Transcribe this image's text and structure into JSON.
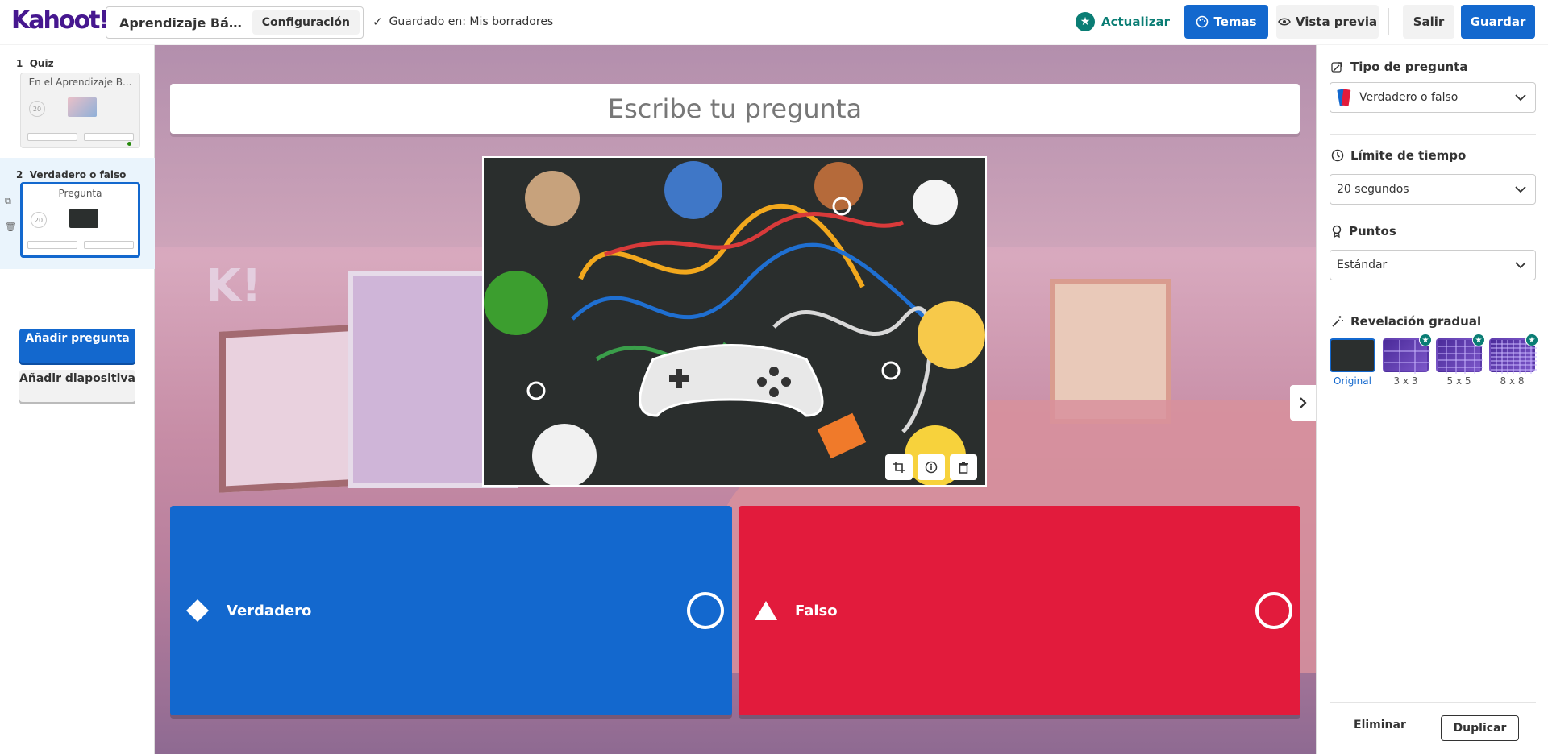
{
  "header": {
    "logo": "Kahoot!",
    "kahoot_title": "Aprendizaje Básico",
    "config_label": "Configuración",
    "saved_status": "Guardado en: Mis borradores",
    "update_label": "Actualizar",
    "themes_label": "Temas",
    "preview_label": "Vista previa",
    "exit_label": "Salir",
    "save_label": "Guardar"
  },
  "sidebar": {
    "slides": [
      {
        "number": "1",
        "type": "Quiz",
        "thumb_title": "En el Aprendizaje B...",
        "timer": "20"
      },
      {
        "number": "2",
        "type": "Verdadero o falso",
        "thumb_title": "Pregunta",
        "timer": "20"
      }
    ],
    "add_question": "Añadir pregunta",
    "add_slide": "Añadir diapositiva"
  },
  "editor": {
    "question_placeholder": "Escribe tu pregunta",
    "answers": [
      {
        "label": "Verdadero",
        "color": "#1368ce",
        "shape": "diamond"
      },
      {
        "label": "Falso",
        "color": "#e21b3c",
        "shape": "triangle"
      }
    ]
  },
  "panel": {
    "question_type_title": "Tipo de pregunta",
    "question_type_value": "Verdadero o falso",
    "time_limit_title": "Límite de tiempo",
    "time_limit_value": "20 segundos",
    "points_title": "Puntos",
    "points_value": "Estándar",
    "reveal_title": "Revelación gradual",
    "reveal_options": [
      "Original",
      "3 x 3",
      "5 x 5",
      "8 x 8"
    ],
    "delete_label": "Eliminar",
    "duplicate_label": "Duplicar"
  }
}
